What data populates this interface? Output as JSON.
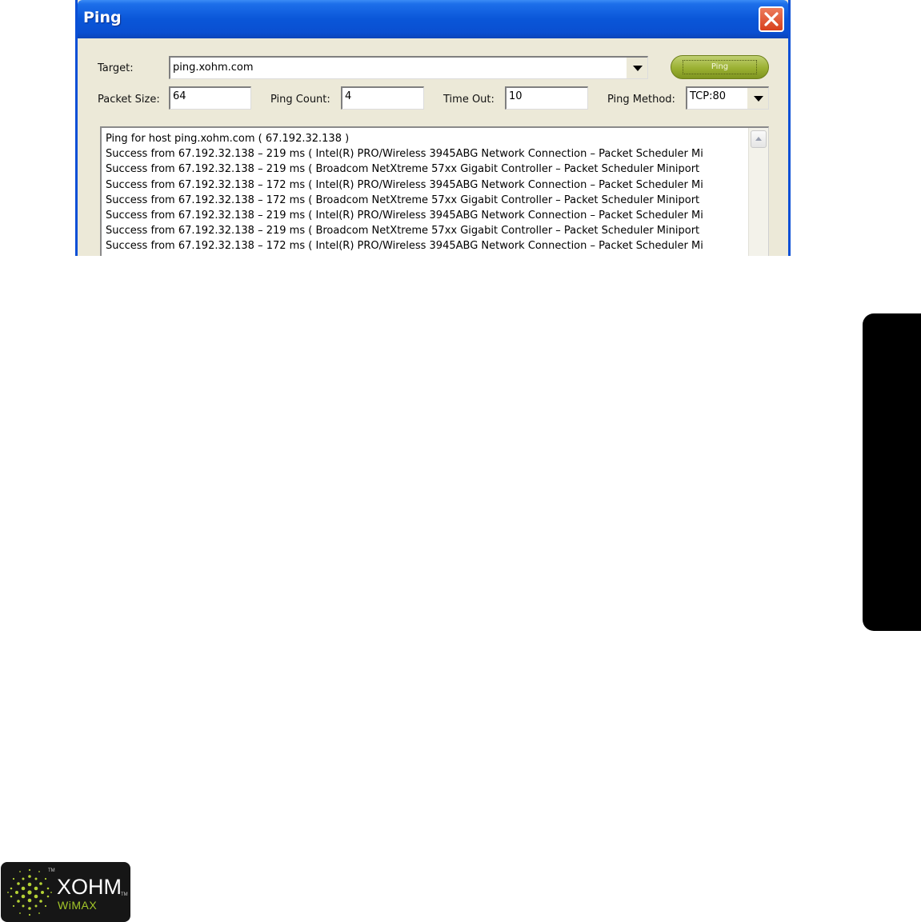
{
  "window": {
    "title": "Ping"
  },
  "form": {
    "target_label": "Target:",
    "target_value": "ping.xohm.com",
    "ping_button_label": "Ping",
    "packet_size_label": "Packet Size:",
    "packet_size_value": "64",
    "ping_count_label": "Ping Count:",
    "ping_count_value": "4",
    "timeout_label": "Time Out:",
    "timeout_value": "10",
    "ping_method_label": "Ping Method:",
    "ping_method_value": "TCP:80"
  },
  "log": [
    "Ping for host  ping.xohm.com ( 67.192.32.138 )",
    "Success  from  67.192.32.138 – 219 ms ( Intel(R) PRO/Wireless 3945ABG Network Connection – Packet Scheduler Mi",
    "Success  from  67.192.32.138 – 219 ms ( Broadcom NetXtreme 57xx Gigabit Controller – Packet Scheduler Miniport",
    "Success  from  67.192.32.138 – 172 ms ( Intel(R) PRO/Wireless 3945ABG Network Connection – Packet Scheduler Mi",
    "Success  from  67.192.32.138 – 172 ms ( Broadcom NetXtreme 57xx Gigabit Controller – Packet Scheduler Miniport",
    "Success  from  67.192.32.138 – 219 ms ( Intel(R) PRO/Wireless 3945ABG Network Connection – Packet Scheduler Mi",
    "Success  from  67.192.32.138 – 219 ms ( Broadcom NetXtreme 57xx Gigabit Controller – Packet Scheduler Miniport",
    "Success  from  67.192.32.138 – 172 ms ( Intel(R) PRO/Wireless 3945ABG Network Connection – Packet Scheduler Mi"
  ],
  "logo": {
    "name": "XOHM",
    "sub": "WiMAX",
    "tm_mark": "TM",
    "accent_color": "#a3c629"
  },
  "icons": {
    "close": "close-icon",
    "dropdown": "chevron-down-icon",
    "scroll_up": "scroll-up-arrow-icon"
  }
}
